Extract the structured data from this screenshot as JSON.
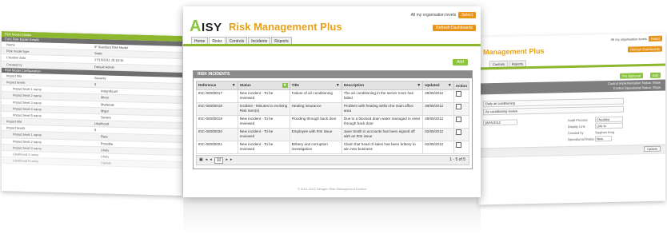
{
  "left_window": {
    "header": "Risk Model Details",
    "section1": "Core Risk Model Details",
    "rows1": [
      {
        "k": "Name",
        "v": "IF Standard Risk Model"
      },
      {
        "k": "Risk model type",
        "v": "Static"
      },
      {
        "k": "Creation date",
        "v": "27/10/2011 15:18:10"
      },
      {
        "k": "Created by",
        "v": "Default Admin"
      }
    ],
    "section2": "Risk Model Configuration",
    "rows2": [
      {
        "k": "Impact title",
        "v": "Severity",
        "in": false
      },
      {
        "k": "Impact levels",
        "v": "5",
        "in": false
      },
      {
        "k": "Impact level 1 name",
        "v": "Insignificant",
        "in": true
      },
      {
        "k": "Impact level 2 name",
        "v": "Minor",
        "in": true
      },
      {
        "k": "Impact level 3 name",
        "v": "Moderate",
        "in": true
      },
      {
        "k": "Impact level 4 name",
        "v": "Major",
        "in": true
      },
      {
        "k": "Impact level 5 name",
        "v": "Severe",
        "in": true
      },
      {
        "k": "Impact title",
        "v": "Likelihood",
        "in": false
      },
      {
        "k": "Impact levels",
        "v": "5",
        "in": false
      },
      {
        "k": "Impact level 1 name",
        "v": "Rare",
        "in": true
      },
      {
        "k": "Impact level 2 name",
        "v": "Possible",
        "in": true
      },
      {
        "k": "Impact level 3 name",
        "v": "Likely",
        "in": true
      },
      {
        "k": "Likelihood 4 name",
        "v": "Likely",
        "in": true
      },
      {
        "k": "Likelihood 5 name",
        "v": "Certain",
        "in": true
      }
    ]
  },
  "right_window": {
    "title": "Management Plus",
    "org_label": "All my organisation levels",
    "select_label": "Select",
    "refresh_label": "Refresh Dashboards",
    "tabs": [
      "Controls",
      "Reports"
    ],
    "btn_pre": "Pre Approval",
    "btn_edit": "Edit",
    "link1": "Control Implementation Status: Show",
    "link2": "Control Operational Status: Show",
    "field1": "Daily air conditioning",
    "field2": "Air conditioning review",
    "audit_label": "Audit Process",
    "audit_value": "Checklist",
    "display_label": "Display Link",
    "display_value": "Link to",
    "created_label": "Created by",
    "created_value": "Stephen King",
    "op_label": "Operational Status",
    "op_value": "New",
    "date_value": "18/05/2012",
    "update_label": "Update"
  },
  "center_window": {
    "logo_text": "ISY",
    "logo_accent": "A",
    "title": "Risk Management Plus",
    "org_label": "All my organisation levels",
    "select_label": "Select",
    "refresh_label": "Refresh Dashboards",
    "tabs": [
      "Home",
      "Risks",
      "Controls",
      "Incidents",
      "Reports"
    ],
    "active_tab": "Risks",
    "add_label": "Add",
    "grid_title": "RISK INCIDENTS",
    "columns": [
      "Reference",
      "Status",
      "Title",
      "Description",
      "Updated",
      "Action"
    ],
    "rows": [
      {
        "ref": "INC-00000017",
        "status": "New incident - To be reviewed",
        "title": "Failure of air conditioning",
        "desc": "The air conditioning in the server room has failed",
        "updated": "29/05/2012"
      },
      {
        "ref": "INC-00000018",
        "status": "Incident - Minutes to evolving Risk Item(s)",
        "title": "Heating insurance",
        "desc": "Problem with heating within the main office area",
        "updated": "29/05/2012"
      },
      {
        "ref": "INC-00000019",
        "status": "New incident - To be reviewed",
        "title": "Flooding through back door",
        "desc": "Due to a blocked drain water managed to enter through back door",
        "updated": "29/05/2012"
      },
      {
        "ref": "INC-00000020",
        "status": "New incident - To be reviewed",
        "title": "Employee with RSI issue",
        "desc": "Jane Smith in accounts has been signed off with an RSI issue",
        "updated": "02/05/2012"
      },
      {
        "ref": "INC-00000021",
        "status": "New incident - To be reviewed",
        "title": "Bribery and corruption investigation",
        "desc": "Claim that head of sales has been bribery to win new business",
        "updated": "02/05/2012"
      }
    ],
    "pager_size": "10",
    "pager_info": "1 - 5 of 5",
    "footer": "© 2011-2012 Ideagen Risk Management Limited"
  },
  "colors": {
    "green": "#8bc53f",
    "orange": "#e8951c",
    "title_orange": "#e8a11a",
    "header_gray": "#8b8b8b"
  }
}
